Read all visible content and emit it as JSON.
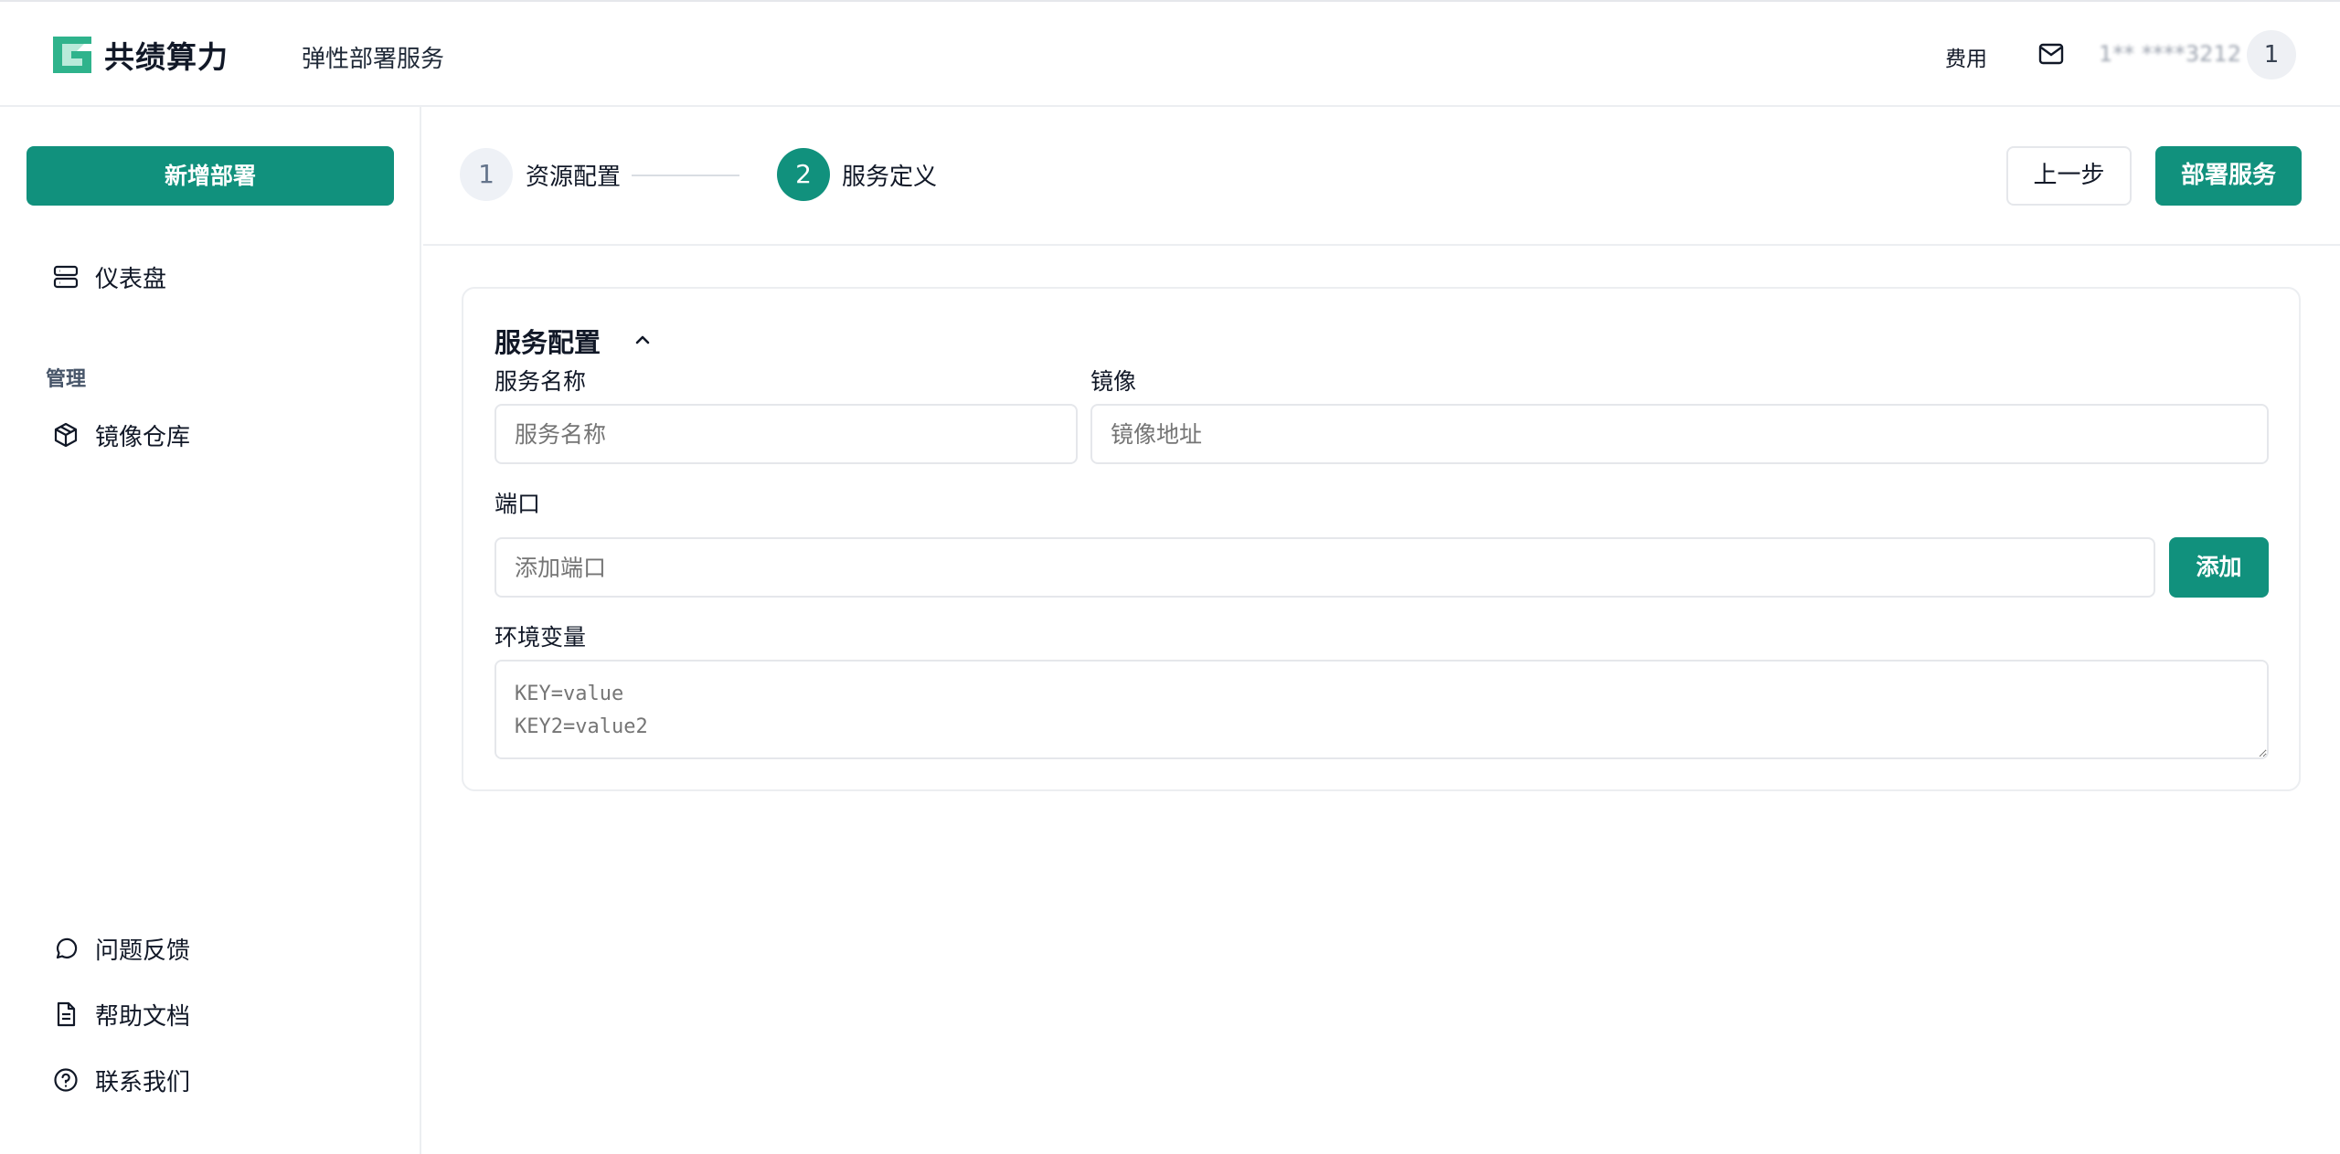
{
  "header": {
    "brand": "共绩算力",
    "product": "弹性部署服务",
    "fee": "费用",
    "phone": "1**  ****3212",
    "avatar": "1"
  },
  "sidebar": {
    "new_button": "新增部署",
    "dashboard": "仪表盘",
    "section_manage": "管理",
    "image_repo": "镜像仓库",
    "feedback": "问题反馈",
    "help_docs": "帮助文档",
    "contact": "联系我们"
  },
  "steps": [
    {
      "number": "1",
      "label": "资源配置",
      "active": false
    },
    {
      "number": "2",
      "label": "服务定义",
      "active": true
    }
  ],
  "actions": {
    "prev": "上一步",
    "deploy": "部署服务"
  },
  "service_config": {
    "title": "服务配置",
    "name_label": "服务名称",
    "name_placeholder": "服务名称",
    "image_label": "镜像",
    "image_placeholder": "镜像地址",
    "port_label": "端口",
    "port_placeholder": "添加端口",
    "add_button": "添加",
    "env_label": "环境变量",
    "env_placeholder": "KEY=value\nKEY2=value2"
  },
  "colors": {
    "accent": "#11917d",
    "border": "#e5e7eb",
    "placeholder": "#94a3b8"
  }
}
